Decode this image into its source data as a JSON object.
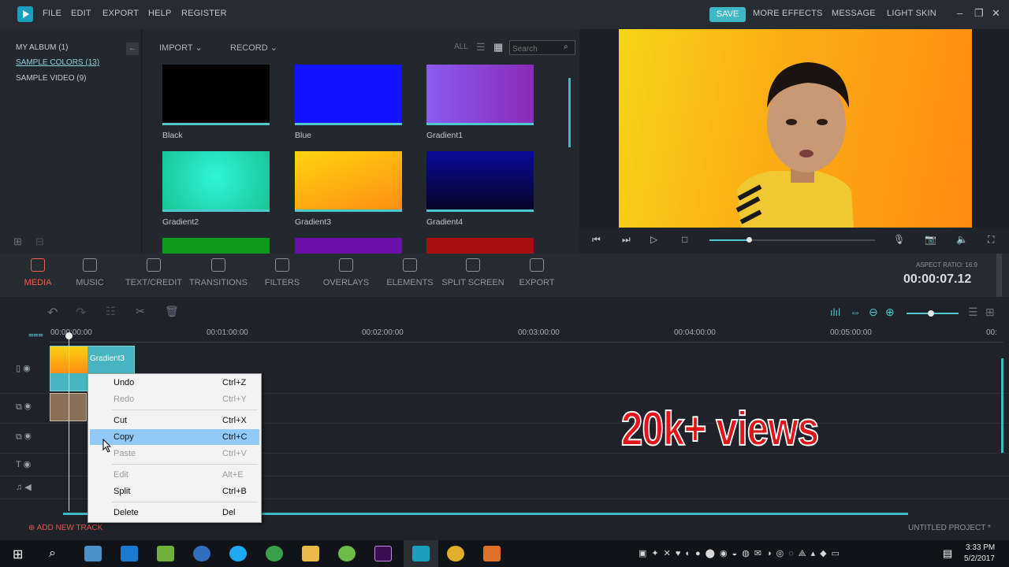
{
  "menu": {
    "file": "FILE",
    "edit": "EDIT",
    "export": "EXPORT",
    "help": "HELP",
    "register": "REGISTER"
  },
  "topright": {
    "save": "SAVE",
    "more_effects": "MORE EFFECTS",
    "message": "MESSAGE",
    "light_skin": "LIGHT SKIN"
  },
  "album": {
    "items": [
      {
        "label": "MY ALBUM (1)"
      },
      {
        "label": "SAMPLE COLORS (13)"
      },
      {
        "label": "SAMPLE VIDEO (9)"
      }
    ]
  },
  "media": {
    "import": "IMPORT",
    "record": "RECORD",
    "all": "ALL",
    "search_placeholder": "Search",
    "thumbs": [
      {
        "label": "Black",
        "color": "#000000"
      },
      {
        "label": "Blue",
        "color": "#1212ff"
      },
      {
        "label": "Gradient1",
        "color": "#9a4fd6"
      },
      {
        "label": "Gradient2",
        "color": "#1fe5c3"
      },
      {
        "label": "Gradient3",
        "color": "#ffb413"
      },
      {
        "label": "Gradient4",
        "color": "#0b0b80"
      }
    ]
  },
  "toolbar": {
    "tools": [
      {
        "label": "MEDIA"
      },
      {
        "label": "MUSIC"
      },
      {
        "label": "TEXT/CREDIT"
      },
      {
        "label": "TRANSITIONS"
      },
      {
        "label": "FILTERS"
      },
      {
        "label": "OVERLAYS"
      },
      {
        "label": "ELEMENTS"
      },
      {
        "label": "SPLIT SCREEN"
      },
      {
        "label": "EXPORT"
      }
    ],
    "aspect_ratio": "ASPECT RATIO: 16:9",
    "timecode": "00:00:07.12"
  },
  "timeline": {
    "ruler": [
      "00:00:00:00",
      "00:01:00:00",
      "00:02:00:00",
      "00:03:00:00",
      "00:04:00:00",
      "00:05:00:00",
      "00:"
    ],
    "clip_name": "Gradient3",
    "add_track": "ADD NEW TRACK",
    "project": "UNTITLED PROJECT *",
    "overlay_text": "20k+ views"
  },
  "context_menu": {
    "items": [
      {
        "label": "Undo",
        "shortcut": "Ctrl+Z"
      },
      {
        "label": "Redo",
        "shortcut": "Ctrl+Y"
      },
      {
        "label": "Cut",
        "shortcut": "Ctrl+X"
      },
      {
        "label": "Copy",
        "shortcut": "Ctrl+C"
      },
      {
        "label": "Paste",
        "shortcut": "Ctrl+V"
      },
      {
        "label": "Edit",
        "shortcut": "Alt+E"
      },
      {
        "label": "Split",
        "shortcut": "Ctrl+B"
      },
      {
        "label": "Delete",
        "shortcut": "Del"
      }
    ]
  },
  "taskbar": {
    "time": "3:33 PM",
    "date": "5/2/2017"
  },
  "colors": {
    "accent": "#3fb7c5",
    "active_tool": "#f0603e",
    "overlay_text": "#e3151b"
  }
}
